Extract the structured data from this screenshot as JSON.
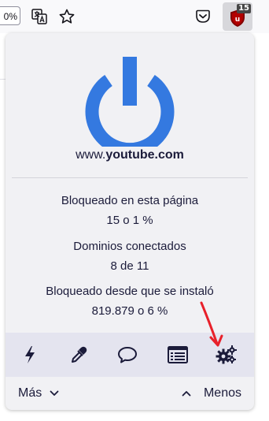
{
  "toolbar": {
    "url_fragment": "0%",
    "ublock_badge": "15",
    "icons": [
      "translate-icon",
      "bookmark-star-icon",
      "pocket-icon",
      "ublock-icon"
    ]
  },
  "popup": {
    "hostname_prefix": "www.",
    "hostname_domain": "youtube.com",
    "stats": {
      "blocked_page_label": "Bloqueado en esta página",
      "blocked_page_value": "15 o 1 %",
      "domains_label": "Dominios conectados",
      "domains_value": "8 de 11",
      "blocked_total_label": "Bloqueado desde que se instaló",
      "blocked_total_value": "819.879 o 6 %"
    },
    "tools": [
      "lightning-icon",
      "eyedropper-icon",
      "speech-bubble-icon",
      "logger-icon",
      "settings-gears-icon"
    ],
    "footer": {
      "more_label": "Más",
      "less_label": "Menos"
    }
  },
  "colors": {
    "power_blue": "#3479e0",
    "accent_red": "#e8202a",
    "tool_row_bg": "#e4e4ef",
    "popup_bg": "#f1f1f4",
    "text": "#1b1b3a"
  }
}
